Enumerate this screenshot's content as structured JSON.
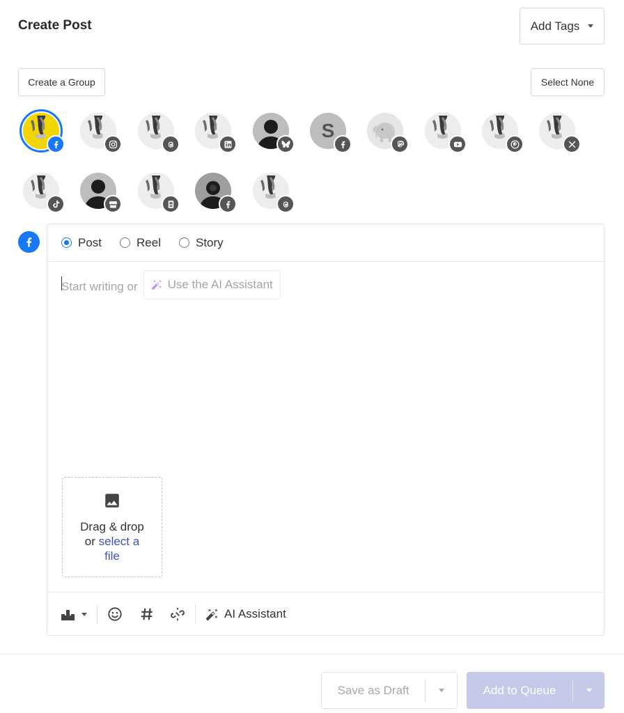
{
  "header": {
    "title": "Create Post",
    "add_tags_label": "Add Tags"
  },
  "groups": {
    "create_group_label": "Create a Group",
    "select_none_label": "Select None"
  },
  "accounts": [
    {
      "avatar": "profile-photo",
      "network": "facebook",
      "selected": true
    },
    {
      "avatar": "profile-photo",
      "network": "instagram",
      "selected": false
    },
    {
      "avatar": "profile-photo",
      "network": "threads",
      "selected": false
    },
    {
      "avatar": "profile-photo",
      "network": "linkedin",
      "selected": false
    },
    {
      "avatar": "default-person",
      "network": "bluesky",
      "selected": false
    },
    {
      "avatar": "letter",
      "letter": "S",
      "network": "facebook",
      "selected": false
    },
    {
      "avatar": "mastodon-elephant",
      "network": "mastodon",
      "selected": false
    },
    {
      "avatar": "profile-photo",
      "network": "youtube",
      "selected": false
    },
    {
      "avatar": "profile-photo",
      "network": "pinterest",
      "selected": false
    },
    {
      "avatar": "profile-photo",
      "network": "x",
      "selected": false
    },
    {
      "avatar": "profile-photo",
      "network": "tiktok",
      "selected": false
    },
    {
      "avatar": "default-person",
      "network": "google-business",
      "selected": false
    },
    {
      "avatar": "profile-photo",
      "network": "page",
      "selected": false
    },
    {
      "avatar": "dark-person",
      "network": "facebook",
      "selected": false
    },
    {
      "avatar": "profile-photo",
      "network": "threads",
      "selected": false
    }
  ],
  "editor": {
    "post_types": [
      {
        "label": "Post",
        "checked": true
      },
      {
        "label": "Reel",
        "checked": false
      },
      {
        "label": "Story",
        "checked": false
      }
    ],
    "placeholder_prefix": "Start writing or",
    "ai_chip_label": "Use the AI Assistant",
    "dropzone": {
      "line1": "Drag & drop",
      "or": "or",
      "link1": "select a",
      "link2": "file"
    },
    "toolbar": {
      "ai_assistant_label": "AI Assistant"
    }
  },
  "footer": {
    "save_draft_label": "Save as Draft",
    "add_queue_label": "Add to Queue"
  },
  "colors": {
    "facebook_blue": "#1877f2",
    "queue_button": "#c5cae9",
    "link": "#3f51b5"
  }
}
